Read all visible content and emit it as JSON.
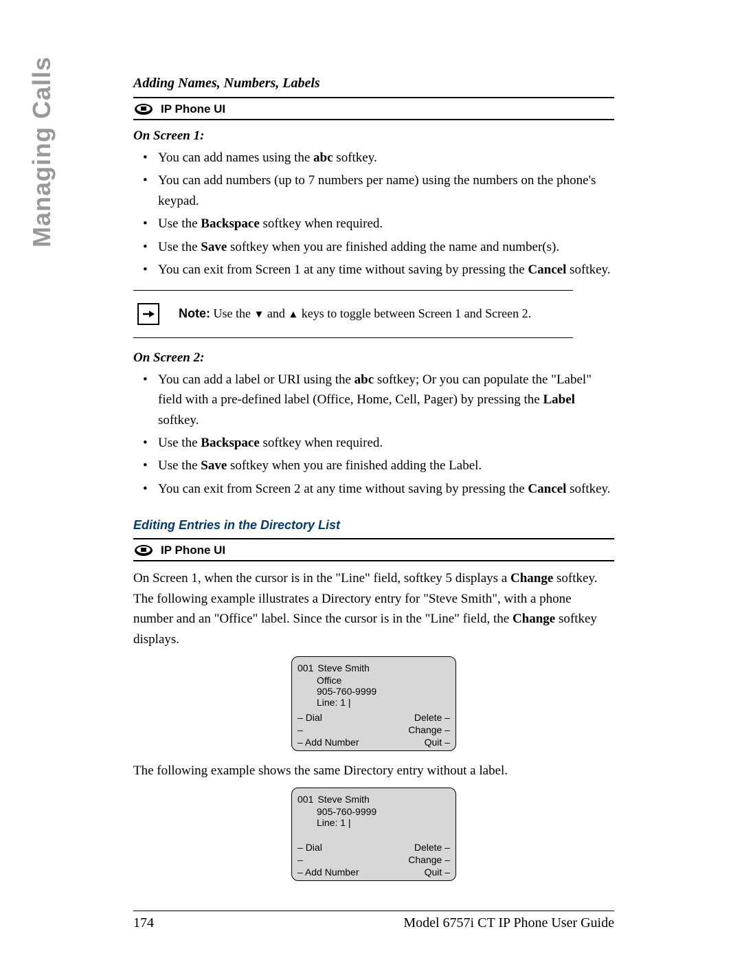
{
  "sidebar": "Managing Calls",
  "title1": "Adding Names, Numbers, Labels",
  "ui_label": "IP Phone UI",
  "screen1_head": "On Screen 1:",
  "screen1_bullets": [
    {
      "pre": "You can add names using the ",
      "b": "abc",
      "post": " softkey."
    },
    {
      "full": "You can add numbers (up to 7 numbers per name) using the numbers on the phone's keypad."
    },
    {
      "pre": "Use the ",
      "b": "Backspace",
      "post": " softkey when required."
    },
    {
      "pre": "Use the ",
      "b": "Save",
      "post": " softkey when you are finished adding the name and number(s)."
    },
    {
      "pre": "You can exit from Screen 1 at any time without saving by pressing the ",
      "b": "Cancel",
      "post": " softkey."
    }
  ],
  "note": {
    "label": "Note:",
    "pre": " Use the ",
    "mid": " and ",
    "post": " keys to toggle between Screen 1 and Screen 2."
  },
  "screen2_head": "On Screen 2:",
  "screen2_bullets": [
    {
      "pre": "You can add a label or URI using the ",
      "b1": "abc",
      "mid": " softkey; Or you can populate the \"Label\" field with a pre-defined label (Office, Home, Cell, Pager) by pressing the ",
      "b2": "Label",
      "post": " softkey."
    },
    {
      "pre": "Use the ",
      "b": "Backspace",
      "post": " softkey when required."
    },
    {
      "pre": "Use the ",
      "b": "Save",
      "post": " softkey when you are finished adding the Label."
    },
    {
      "pre": "You can exit from Screen 2 at any time without saving by pressing the ",
      "b": "Cancel",
      "post": " softkey."
    }
  ],
  "edit_head": "Editing Entries in the Directory List",
  "para1": {
    "p1": "On Screen 1, when the cursor is in the \"Line\" field, softkey 5 displays a ",
    "b1": "Change",
    "p2": " softkey. The following example illustrates a Directory entry for \"Steve Smith\", with a phone number and an \"Office\" label. Since the cursor is in the \"Line\" field, the ",
    "b2": "Change",
    "p3": " softkey displays."
  },
  "para2": "The following example shows the same Directory entry without a label.",
  "phone1": {
    "idx": "001",
    "name": "Steve Smith",
    "label": "Office",
    "number": "905-760-9999",
    "line": "Line: 1 |",
    "l1": "Dial",
    "l3": "Add Number",
    "r1": "Delete",
    "r2": "Change",
    "r3": "Quit"
  },
  "phone2": {
    "idx": "001",
    "name": "Steve Smith",
    "number": "905-760-9999",
    "line": "Line: 1 |",
    "l1": "Dial",
    "l3": "Add Number",
    "r1": "Delete",
    "r2": "Change",
    "r3": "Quit"
  },
  "footer": {
    "page": "174",
    "guide": "Model 6757i CT IP Phone User Guide"
  }
}
